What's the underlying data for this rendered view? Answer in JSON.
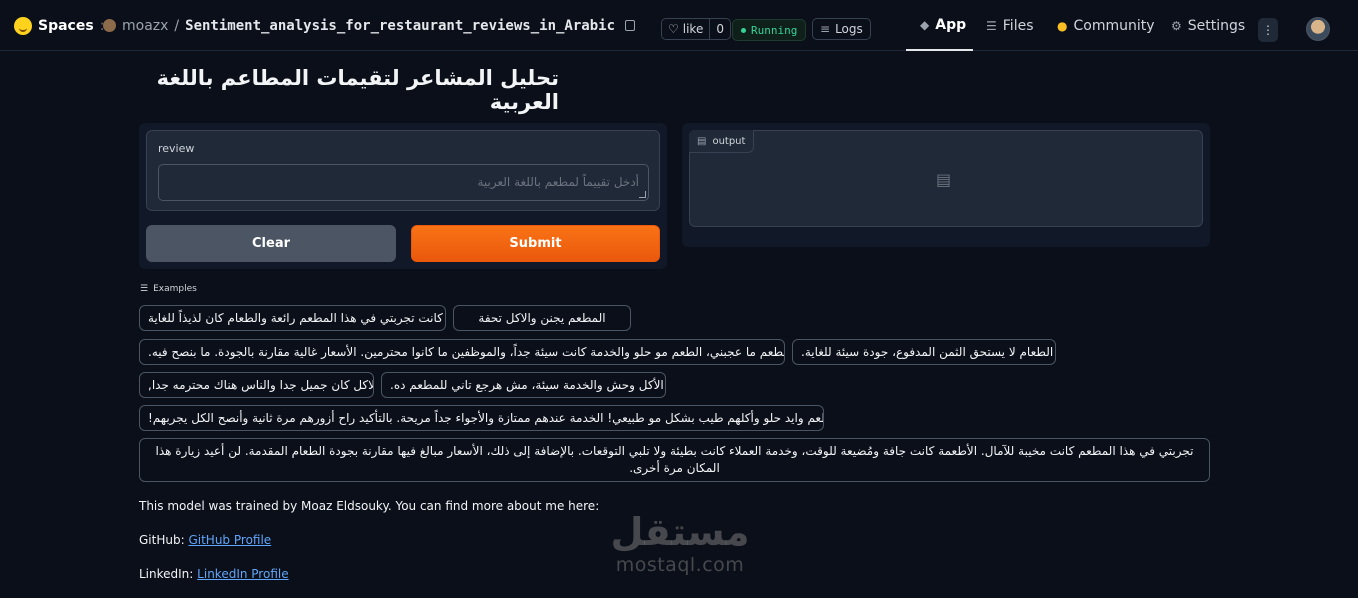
{
  "topbar": {
    "spaces_label": "Spaces",
    "owner": "moazx",
    "repo_name": "Sentiment_analysis_for_restaurant_reviews_in_Arabic",
    "like_label": "like",
    "like_count": "0",
    "status": "Running",
    "logs_label": "Logs",
    "nav": {
      "app": "App",
      "files": "Files",
      "community": "Community",
      "settings": "Settings"
    }
  },
  "page": {
    "title": "تحليل المشاعر لتقيمات المطاعم باللغة العربية"
  },
  "input": {
    "label": "review",
    "placeholder": "أدخل تقييماً لمطعم باللغة العربية",
    "value": ""
  },
  "buttons": {
    "clear": "Clear",
    "submit": "Submit"
  },
  "output": {
    "label": "output"
  },
  "examples": {
    "header": "Examples",
    "items": [
      "كانت تجربتي في هذا المطعم رائعة والطعام كان لذيذاً للغاية",
      "المطعم يجنن والاكل تحفة",
      "المطعم ما عجبني، الطعم مو حلو والخدمة كانت سيئة جداً، والموظفين ما كانوا محترمين. الأسعار غالية مقارنة بالجودة. ما بنصح فيه.",
      "الطعام لا يستحق الثمن المدفوع، جودة سيئة للغاية.",
      "الاكل كان جميل جدا والناس هناك محترمه جدا,",
      "الأكل وحش والخدمة سيئة، مش هرجع تاني للمطعم ده.",
      "المطعم وايد حلو وأكلهم طيب بشكل مو طبيعي! الخدمة عندهم ممتازة والأجواء جداً مريحة. بالتأكيد راح أزورهم مرة ثانية وأنصح الكل يجربهم!",
      "تجربتي في هذا المطعم كانت مخيبة للآمال. الأطعمة كانت جافة ومُضيعة للوقت، وخدمة العملاء كانت بطيئة ولا تلبي التوقعات. بالإضافة إلى ذلك، الأسعار مبالغ فيها مقارنة بجودة الطعام المقدمة. لن أعيد زيارة هذا المكان مرة أخرى."
    ]
  },
  "footer": {
    "about": "This model was trained by Moaz Eldsouky. You can find more about me here:",
    "github_label": "GitHub:",
    "github_link": "GitHub Profile",
    "linkedin_label": "LinkedIn:",
    "linkedin_link": "LinkedIn Profile"
  },
  "watermark": {
    "arabic": "مستقل",
    "latin": "mostaql.com"
  },
  "colors": {
    "accent": "#f97316",
    "background": "#0b0f19",
    "running": "#34d399",
    "link": "#60a5fa"
  }
}
